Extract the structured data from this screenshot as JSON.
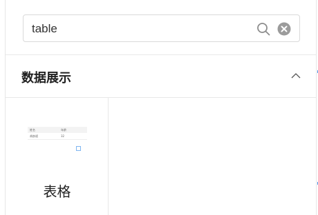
{
  "search": {
    "value": "table"
  },
  "section": {
    "title": "数据展示",
    "expanded": true
  },
  "components": [
    {
      "label": "表格",
      "thumbnail": {
        "header": [
          "姓名",
          "年龄"
        ],
        "row": [
          "胡彦斌",
          "32"
        ]
      }
    }
  ],
  "colors": {
    "border": "#e8e8e8",
    "icon": "#8c8c8c",
    "clear_icon": "#9b9b9b",
    "accent": "#4a90e2"
  },
  "icons": {
    "search": "search-icon",
    "clear": "close-circle-icon",
    "collapse": "chevron-up-icon"
  }
}
